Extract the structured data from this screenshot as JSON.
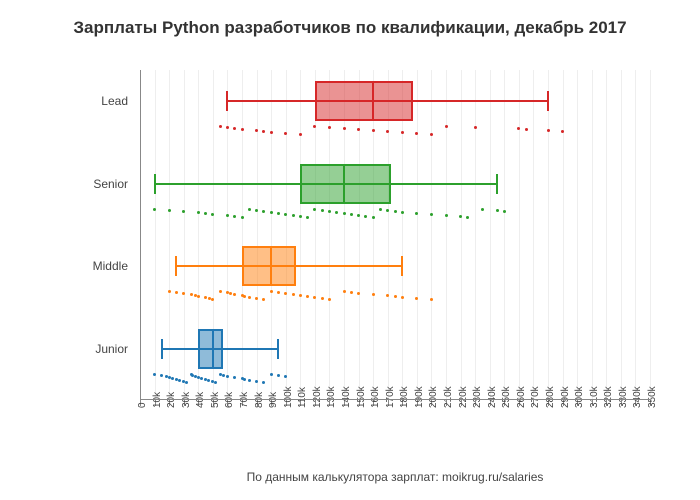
{
  "title": "Зарплаты Python разработчиков по квалификации, декабрь 2017",
  "xlabel": "По данным калькулятора зарплат: moikrug.ru/salaries",
  "chart_data": {
    "type": "box",
    "orientation": "horizontal",
    "xlim": [
      0,
      350
    ],
    "xticks": [
      0,
      10,
      20,
      30,
      40,
      50,
      60,
      70,
      80,
      90,
      100,
      110,
      120,
      130,
      140,
      150,
      160,
      170,
      180,
      190,
      200,
      210,
      220,
      230,
      240,
      250,
      260,
      270,
      280,
      290,
      300,
      310,
      320,
      330,
      340,
      350
    ],
    "xtick_labels": [
      "0",
      "10k",
      "20k",
      "30k",
      "40k",
      "50k",
      "60k",
      "70k",
      "80k",
      "90k",
      "100k",
      "110k",
      "120k",
      "130k",
      "140k",
      "150k",
      "160k",
      "170k",
      "180k",
      "190k",
      "200k",
      "210k",
      "220k",
      "230k",
      "240k",
      "250k",
      "260k",
      "270k",
      "280k",
      "290k",
      "300k",
      "310k",
      "320k",
      "330k",
      "340k",
      "350k"
    ],
    "categories": [
      "Junior",
      "Middle",
      "Senior",
      "Lead"
    ],
    "series": [
      {
        "name": "Junior",
        "color": "#1f77b4",
        "fill": "rgba(31,119,180,0.5)",
        "whisker_low": 15,
        "q1": 40,
        "median": 50,
        "q3": 60,
        "whisker_high": 95,
        "points": [
          10,
          15,
          18,
          20,
          22,
          25,
          27,
          30,
          32,
          35,
          36,
          38,
          40,
          42,
          45,
          47,
          50,
          52,
          55,
          57,
          60,
          65,
          70,
          72,
          75,
          80,
          85,
          90,
          95,
          100
        ]
      },
      {
        "name": "Middle",
        "color": "#ff7f0e",
        "fill": "rgba(255,127,14,0.5)",
        "whisker_low": 25,
        "q1": 70,
        "median": 90,
        "q3": 110,
        "whisker_high": 180,
        "points": [
          20,
          25,
          30,
          35,
          38,
          40,
          45,
          48,
          50,
          55,
          60,
          62,
          65,
          70,
          72,
          75,
          80,
          85,
          90,
          95,
          100,
          105,
          110,
          115,
          120,
          125,
          130,
          140,
          145,
          150,
          160,
          170,
          175,
          180,
          190,
          200
        ]
      },
      {
        "name": "Senior",
        "color": "#2ca02c",
        "fill": "rgba(44,160,44,0.5)",
        "whisker_low": 10,
        "q1": 110,
        "median": 140,
        "q3": 175,
        "whisker_high": 245,
        "points": [
          10,
          20,
          30,
          40,
          45,
          50,
          60,
          65,
          70,
          75,
          80,
          85,
          90,
          95,
          100,
          105,
          110,
          115,
          120,
          125,
          130,
          135,
          140,
          145,
          150,
          155,
          160,
          165,
          170,
          175,
          180,
          190,
          200,
          210,
          220,
          225,
          235,
          245,
          250
        ]
      },
      {
        "name": "Lead",
        "color": "#d62728",
        "fill": "rgba(214,39,40,0.5)",
        "whisker_low": 60,
        "q1": 120,
        "median": 160,
        "q3": 190,
        "whisker_high": 280,
        "points": [
          55,
          60,
          65,
          70,
          80,
          85,
          90,
          100,
          110,
          120,
          130,
          140,
          150,
          160,
          170,
          180,
          190,
          200,
          210,
          230,
          260,
          265,
          280,
          290
        ]
      }
    ]
  }
}
